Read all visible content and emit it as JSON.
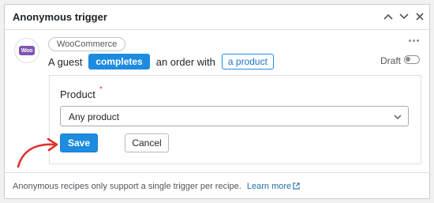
{
  "panel": {
    "title": "Anonymous trigger"
  },
  "trigger": {
    "icon_badge": "Woo",
    "integration": "WooCommerce",
    "sentence": {
      "prefix": "A guest",
      "action_token": "completes",
      "middle": "an order with",
      "object_token": "a product"
    },
    "status_label": "Draft",
    "status_enabled": false
  },
  "form": {
    "field_label": "Product",
    "required_marker": "*",
    "select_value": "Any product",
    "save_label": "Save",
    "cancel_label": "Cancel"
  },
  "footer": {
    "note": "Anonymous recipes only support a single trigger per recipe.",
    "link_label": "Learn more"
  },
  "colors": {
    "accent": "#1d8ce0",
    "annotation_arrow": "#e0332f",
    "woo_purple": "#7f54b3"
  },
  "icons": [
    "chevron-up-icon",
    "chevron-down-icon",
    "close-icon",
    "more-options-icon",
    "woocommerce-icon",
    "toggle-switch",
    "chevron-down-icon",
    "external-link-icon",
    "annotation-arrow"
  ]
}
